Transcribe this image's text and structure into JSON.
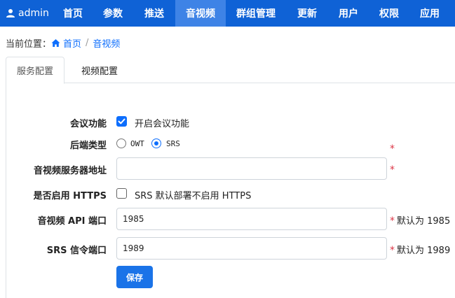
{
  "nav": {
    "user": "admin",
    "items": [
      {
        "label": "首页"
      },
      {
        "label": "参数"
      },
      {
        "label": "推送"
      },
      {
        "label": "音视频",
        "active": true
      },
      {
        "label": "群组管理"
      },
      {
        "label": "更新"
      },
      {
        "label": "用户"
      },
      {
        "label": "权限"
      },
      {
        "label": "应用"
      }
    ]
  },
  "breadcrumb": {
    "prefix": "当前位置：",
    "home": "首页",
    "separator": "/",
    "current": "音视频"
  },
  "tabs": [
    {
      "label": "服务配置",
      "active": true
    },
    {
      "label": "视频配置",
      "active": false
    }
  ],
  "form": {
    "meeting": {
      "label": "会议功能",
      "checkbox_label": "开启会议功能",
      "checked": true
    },
    "backend": {
      "label": "后端类型",
      "options": [
        "OWT",
        "SRS"
      ],
      "selected": "SRS"
    },
    "server_address": {
      "label": "音视频服务器地址",
      "value": ""
    },
    "https": {
      "label": "是否启用 HTTPS",
      "checkbox_label": "SRS 默认部署不启用 HTTPS",
      "checked": false
    },
    "api_port": {
      "label": "音视频 API 端口",
      "value": "1985",
      "hint": "默认为 1985"
    },
    "signal_port": {
      "label": "SRS 信令端口",
      "value": "1989",
      "hint": "默认为 1989"
    },
    "required_mark": "*",
    "save_label": "保存"
  },
  "colors": {
    "nav_bg": "#0f62d6",
    "nav_active": "#3e83e6",
    "primary": "#0d6efd",
    "required": "#dc3545"
  }
}
